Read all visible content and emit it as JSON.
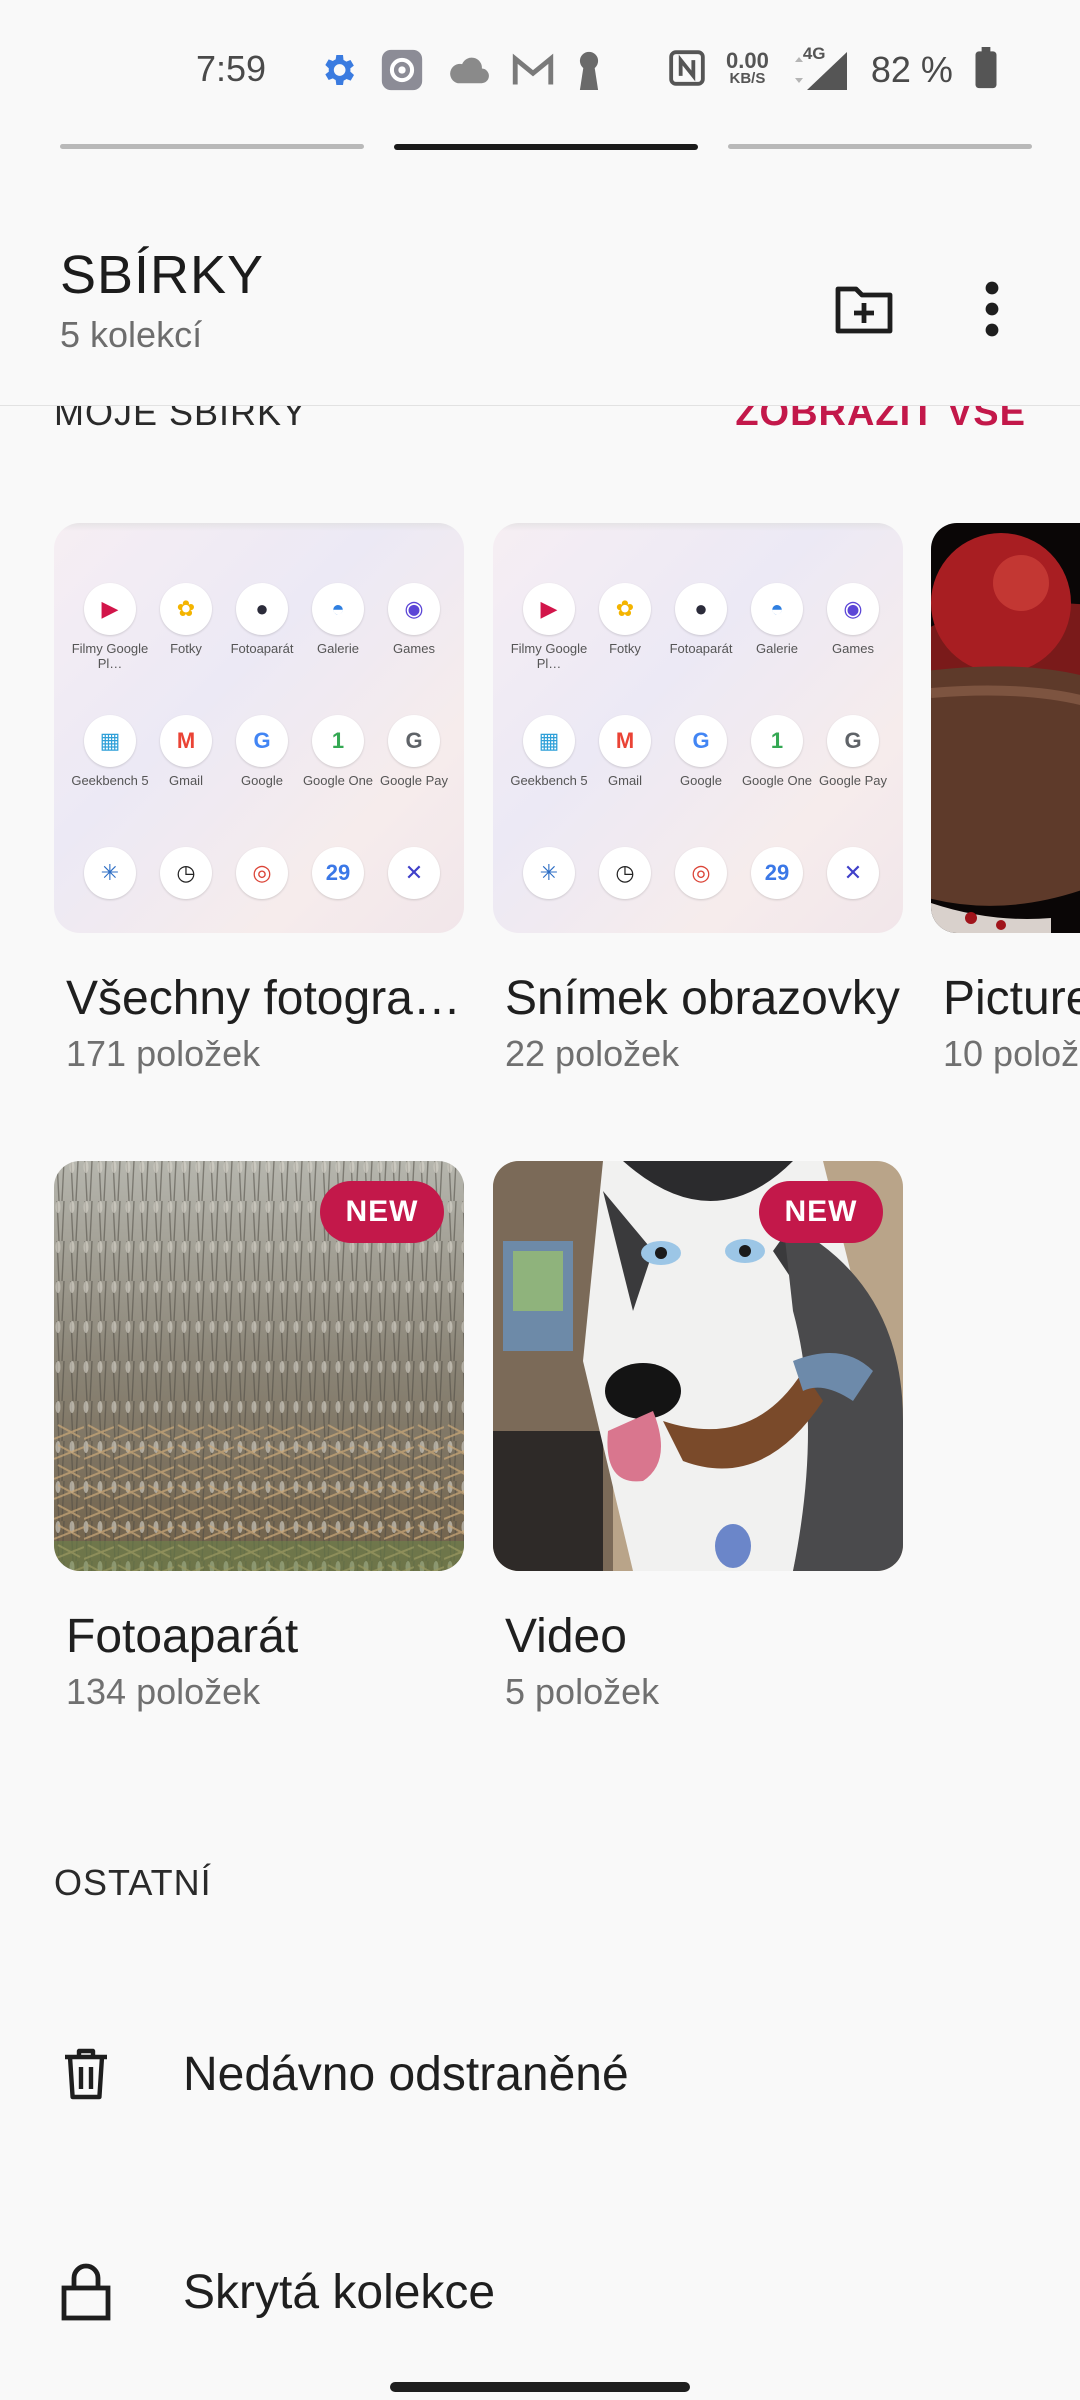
{
  "status_bar": {
    "time": "7:59",
    "net_speed_value": "0.00",
    "net_speed_unit": "KB/S",
    "network_type": "4G",
    "battery": "82 %",
    "icons": [
      "settings-gear-icon",
      "app-settings-icon",
      "cloud-icon",
      "gmail-icon",
      "keyhole-icon",
      "nfc-icon",
      "signal-icon",
      "battery-icon"
    ]
  },
  "pager": {
    "pages": 3,
    "active_index": 1
  },
  "header": {
    "title": "SBÍRKY",
    "subtitle": "5 kolekcí",
    "new_folder_icon": "folder-plus-icon",
    "more_icon": "more-vert-icon"
  },
  "my_collections": {
    "label": "MOJE SBÍRKY",
    "see_all": "ZOBRAZIT VŠE",
    "albums": [
      {
        "name": "Všechny fotogra…",
        "count": "171 položek",
        "thumb": "screenshot"
      },
      {
        "name": "Snímek obrazovky",
        "count": "22 položek",
        "thumb": "screenshot"
      },
      {
        "name": "Picture",
        "count": "10 polož",
        "thumb": "pomegranate"
      },
      {
        "name": "Fotoaparát",
        "count": "134 položek",
        "thumb": "wheat-field",
        "badge": "NEW"
      },
      {
        "name": "Video",
        "count": "5 položek",
        "thumb": "husky",
        "badge": "NEW"
      }
    ]
  },
  "thumbnail_apps": [
    {
      "label": "Filmy Google Pl…",
      "glyph": "▶",
      "color": "#d2154a"
    },
    {
      "label": "Fotky",
      "glyph": "✿",
      "color": "#f4b400"
    },
    {
      "label": "Fotoaparát",
      "glyph": "●",
      "color": "#2b2b3a"
    },
    {
      "label": "Galerie",
      "glyph": "◓",
      "color": "#2f7fe0"
    },
    {
      "label": "Games",
      "glyph": "◉",
      "color": "#5b45d6"
    },
    {
      "label": "Geekbench 5",
      "glyph": "▦",
      "color": "#2fa0d8"
    },
    {
      "label": "Gmail",
      "glyph": "M",
      "color": "#ea4335"
    },
    {
      "label": "Google",
      "glyph": "G",
      "color": "#4285f4"
    },
    {
      "label": "Google One",
      "glyph": "1",
      "color": "#34a853"
    },
    {
      "label": "Google Pay",
      "glyph": "G",
      "color": "#5f6368"
    },
    {
      "label": "",
      "glyph": "✳",
      "color": "#2b6cc4"
    },
    {
      "label": "",
      "glyph": "◷",
      "color": "#222"
    },
    {
      "label": "",
      "glyph": "◎",
      "color": "#db4437"
    },
    {
      "label": "",
      "glyph": "29",
      "color": "#3b78e7"
    },
    {
      "label": "",
      "glyph": "✕",
      "color": "#3f3fc9"
    }
  ],
  "other": {
    "label": "OSTATNÍ",
    "items": [
      {
        "label": "Nedávno odstraněné",
        "icon": "trash-icon"
      },
      {
        "label": "Skrytá kolekce",
        "icon": "lock-icon"
      }
    ]
  },
  "colors": {
    "accent": "#c3184a",
    "background": "#f9f9f9",
    "text": "#1f1f1f",
    "secondary_text": "#707070"
  }
}
